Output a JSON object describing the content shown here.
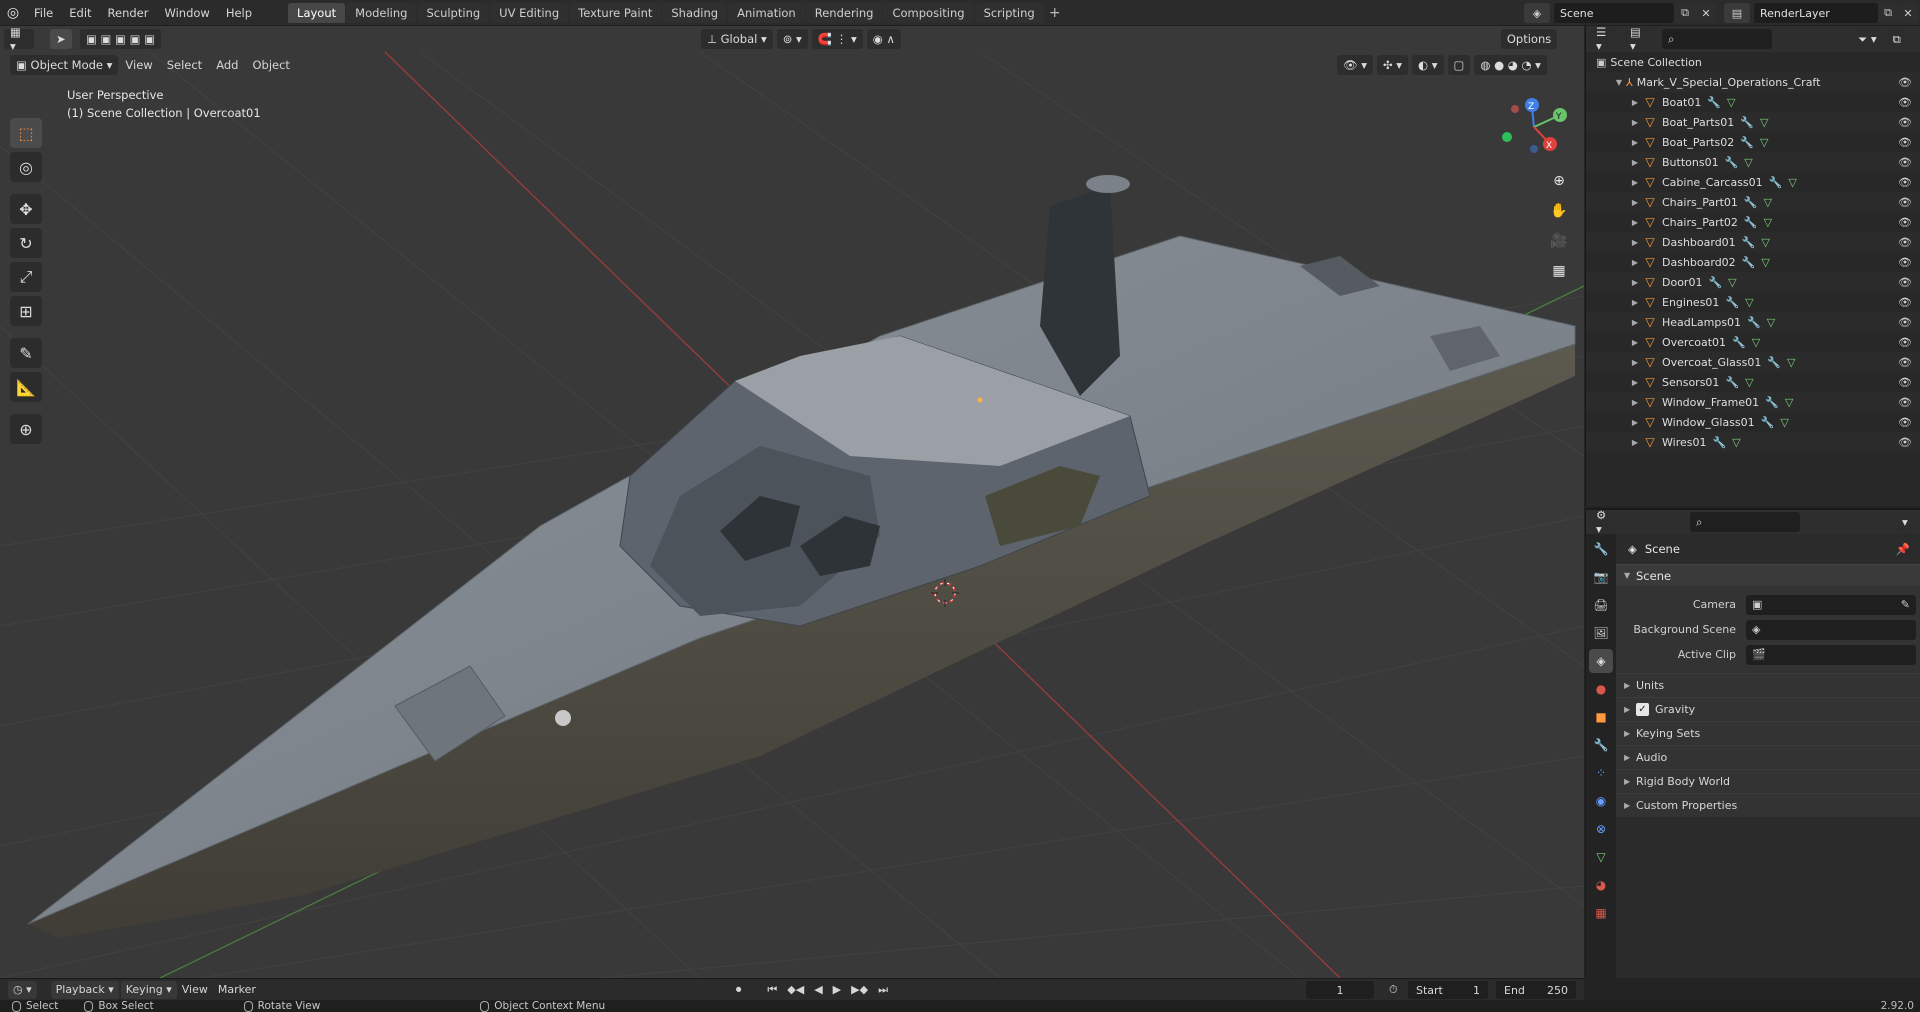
{
  "app": {
    "menus": [
      "File",
      "Edit",
      "Render",
      "Window",
      "Help"
    ],
    "workspaces": [
      "Layout",
      "Modeling",
      "Sculpting",
      "UV Editing",
      "Texture Paint",
      "Shading",
      "Animation",
      "Rendering",
      "Compositing",
      "Scripting"
    ],
    "active_workspace": "Layout",
    "scene_name": "Scene",
    "view_layer": "RenderLayer"
  },
  "viewport": {
    "mode": "Object Mode",
    "menus": [
      "View",
      "Select",
      "Add",
      "Object"
    ],
    "transform_orientation": "Global",
    "options_label": "Options",
    "perspective_label": "User Perspective",
    "collection_label": "(1) Scene Collection | Overcoat01",
    "gizmo": {
      "x": "X",
      "y": "Y",
      "z": "Z"
    }
  },
  "outliner": {
    "root": "Scene Collection",
    "collection": "Mark_V_Special_Operations_Craft",
    "objects": [
      "Boat01",
      "Boat_Parts01",
      "Boat_Parts02",
      "Buttons01",
      "Cabine_Carcass01",
      "Chairs_Part01",
      "Chairs_Part02",
      "Dashboard01",
      "Dashboard02",
      "Door01",
      "Engines01",
      "HeadLamps01",
      "Overcoat01",
      "Overcoat_Glass01",
      "Sensors01",
      "Window_Frame01",
      "Window_Glass01",
      "Wires01"
    ],
    "selected": "Overcoat01"
  },
  "properties": {
    "context_title": "Scene",
    "panel": "Scene",
    "fields": [
      {
        "label": "Camera",
        "value": ""
      },
      {
        "label": "Background Scene",
        "value": ""
      },
      {
        "label": "Active Clip",
        "value": ""
      }
    ],
    "subpanels": [
      "Units",
      "Gravity",
      "Keying Sets",
      "Audio",
      "Rigid Body World",
      "Custom Properties"
    ],
    "gravity_checked": true
  },
  "timeline": {
    "menus": [
      "Playback",
      "Keying",
      "View",
      "Marker"
    ],
    "current_frame": "1",
    "start_label": "Start",
    "start": "1",
    "end_label": "End",
    "end": "250"
  },
  "statusbar": {
    "items": [
      "Select",
      "Box Select",
      "Rotate View",
      "Object Context Menu"
    ],
    "version": "2.92.0"
  },
  "colors": {
    "accent": "#ff8a3d",
    "selection": "#334d80",
    "x_axis": "#e0403c",
    "y_axis": "#6ac36a",
    "z_axis": "#3f7fe6"
  }
}
